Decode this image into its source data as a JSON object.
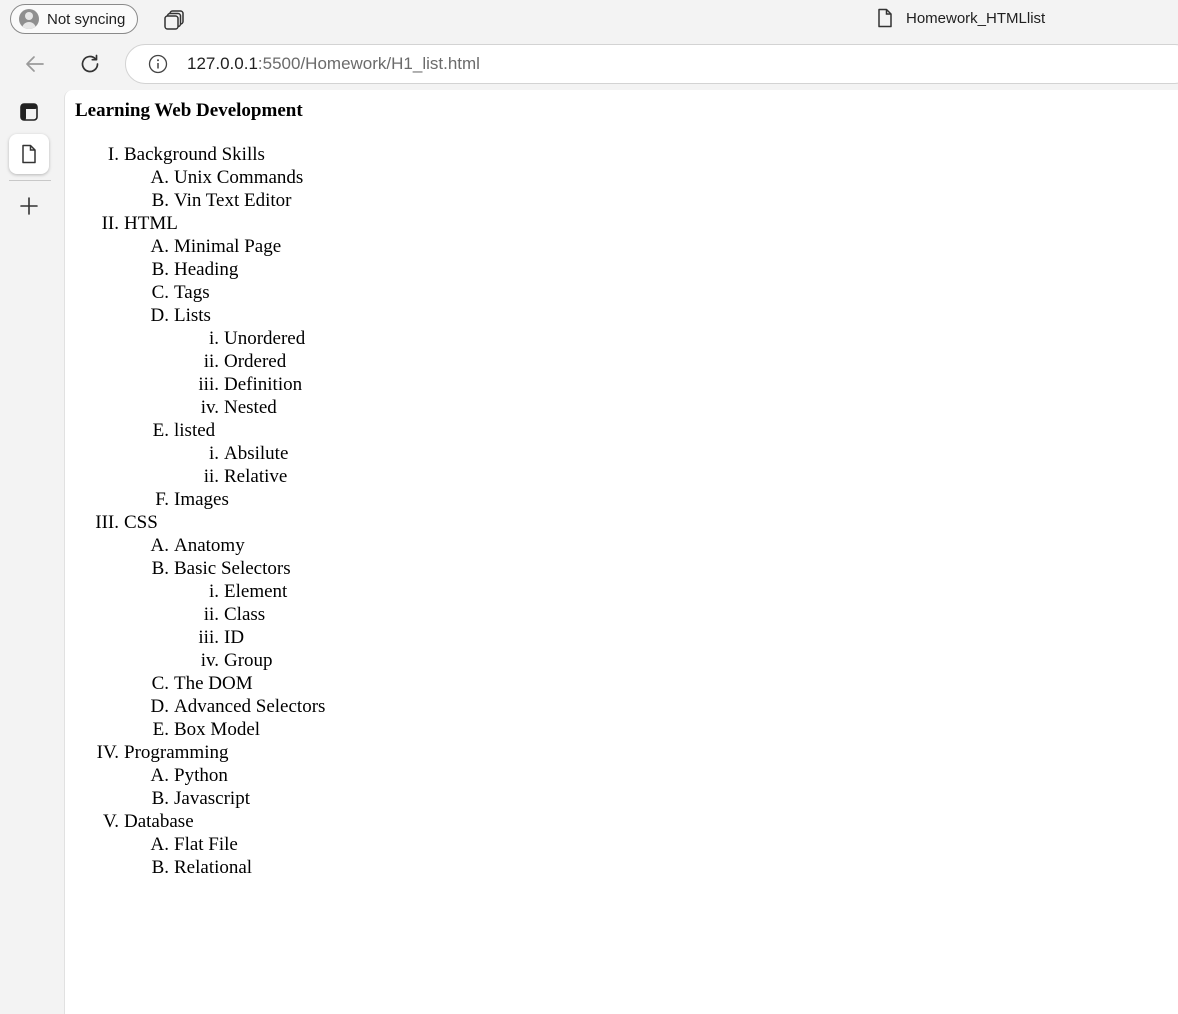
{
  "browser": {
    "profile_label": "Not syncing",
    "tab_title": "Homework_HTMLlist",
    "url_host": "127.0.0.1",
    "url_rest": ":5500/Homework/H1_list.html"
  },
  "page": {
    "heading": "Learning Web Development",
    "outline": [
      {
        "marker": "I.",
        "text": "Background Skills",
        "children": [
          {
            "marker": "A.",
            "text": "Unix Commands",
            "children": []
          },
          {
            "marker": "B.",
            "text": "Vin Text Editor",
            "children": []
          }
        ]
      },
      {
        "marker": "II.",
        "text": "HTML",
        "children": [
          {
            "marker": "A.",
            "text": "Minimal Page",
            "children": []
          },
          {
            "marker": "B.",
            "text": "Heading",
            "children": []
          },
          {
            "marker": "C.",
            "text": "Tags",
            "children": []
          },
          {
            "marker": "D.",
            "text": "Lists",
            "children": [
              {
                "marker": "i.",
                "text": "Unordered"
              },
              {
                "marker": "ii.",
                "text": "Ordered"
              },
              {
                "marker": "iii.",
                "text": "Definition"
              },
              {
                "marker": "iv.",
                "text": "Nested"
              }
            ]
          },
          {
            "marker": "E.",
            "text": "listed",
            "children": [
              {
                "marker": "i.",
                "text": "Absilute"
              },
              {
                "marker": "ii.",
                "text": "Relative"
              }
            ]
          },
          {
            "marker": "F.",
            "text": "Images",
            "children": []
          }
        ]
      },
      {
        "marker": "III.",
        "text": "CSS",
        "children": [
          {
            "marker": "A.",
            "text": "Anatomy",
            "children": []
          },
          {
            "marker": "B.",
            "text": "Basic Selectors",
            "children": [
              {
                "marker": "i.",
                "text": "Element"
              },
              {
                "marker": "ii.",
                "text": "Class"
              },
              {
                "marker": "iii.",
                "text": "ID"
              },
              {
                "marker": "iv.",
                "text": "Group"
              }
            ]
          },
          {
            "marker": "C.",
            "text": "The DOM",
            "children": []
          },
          {
            "marker": "D.",
            "text": "Advanced Selectors",
            "children": []
          },
          {
            "marker": "E.",
            "text": "Box Model",
            "children": []
          }
        ]
      },
      {
        "marker": "IV.",
        "text": "Programming",
        "children": [
          {
            "marker": "A.",
            "text": "Python",
            "children": []
          },
          {
            "marker": "B.",
            "text": "Javascript",
            "children": []
          }
        ]
      },
      {
        "marker": "V.",
        "text": "Database",
        "children": [
          {
            "marker": "A.",
            "text": "Flat File",
            "children": []
          },
          {
            "marker": "B.",
            "text": "Relational",
            "children": []
          }
        ]
      }
    ]
  }
}
